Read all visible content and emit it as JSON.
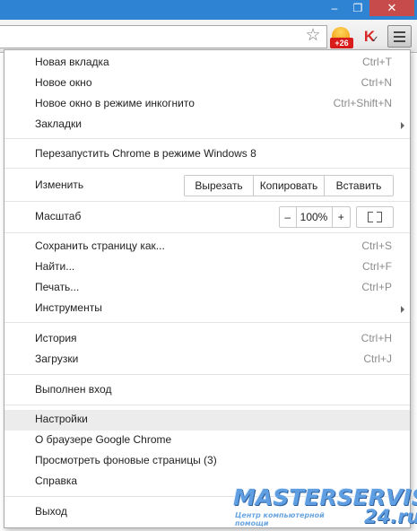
{
  "window": {
    "controls": {
      "minimize": "–",
      "maximize": "❐",
      "close": "✕"
    }
  },
  "toolbar": {
    "star_icon": "☆",
    "extension_badge": "+26",
    "kaspersky_icon": "K",
    "kaspersky_tick": "✓"
  },
  "menu": {
    "items": {
      "new_tab": {
        "label": "Новая вкладка",
        "shortcut": "Ctrl+T"
      },
      "new_window": {
        "label": "Новое окно",
        "shortcut": "Ctrl+N"
      },
      "incognito": {
        "label": "Новое окно в режиме инкогнито",
        "shortcut": "Ctrl+Shift+N"
      },
      "bookmarks": {
        "label": "Закладки"
      },
      "relaunch": {
        "label": "Перезапустить Chrome в режиме Windows 8"
      },
      "edit": {
        "label": "Изменить",
        "cut": "Вырезать",
        "copy": "Копировать",
        "paste": "Вставить"
      },
      "zoom": {
        "label": "Масштаб",
        "minus": "–",
        "value": "100%",
        "plus": "+"
      },
      "save_page": {
        "label": "Сохранить страницу как...",
        "shortcut": "Ctrl+S"
      },
      "find": {
        "label": "Найти...",
        "shortcut": "Ctrl+F"
      },
      "print": {
        "label": "Печать...",
        "shortcut": "Ctrl+P"
      },
      "tools": {
        "label": "Инструменты"
      },
      "history": {
        "label": "История",
        "shortcut": "Ctrl+H"
      },
      "downloads": {
        "label": "Загрузки",
        "shortcut": "Ctrl+J"
      },
      "signed_in": {
        "label": "Выполнен вход"
      },
      "settings": {
        "label": "Настройки"
      },
      "about": {
        "label": "О браузере Google Chrome"
      },
      "background_pages": {
        "label": "Просмотреть фоновые страницы (3)"
      },
      "help": {
        "label": "Справка"
      },
      "exit": {
        "label": "Выход"
      }
    }
  },
  "watermark": {
    "title": "MASTERSERVIS",
    "subtitle": "Центр компьютерной помощи",
    "domain": "24.ru"
  },
  "colors": {
    "titlebar": "#2e84d3",
    "close_button": "#c74b4b",
    "highlight": "#ececec",
    "watermark": "#5f9ee0"
  }
}
